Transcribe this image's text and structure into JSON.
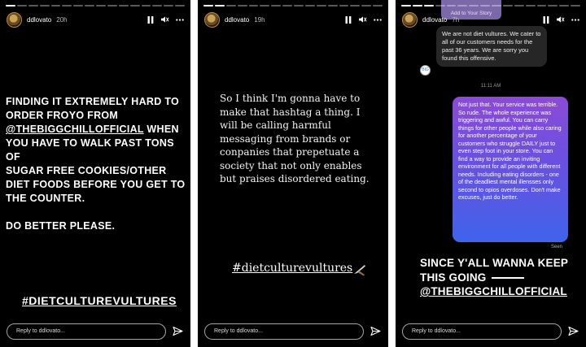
{
  "stories": [
    {
      "username": "ddlovato",
      "time": "20h",
      "progress": [
        1,
        0,
        0,
        0,
        0,
        0,
        0,
        0,
        0,
        0,
        0,
        0,
        0,
        0,
        0,
        0
      ],
      "text_lines": [
        "FINDING IT EXTREMELY HARD TO",
        "ORDER FROYO FROM",
        "@THEBIGGCHILLOFFICIAL",
        "WHEN",
        "YOU HAVE TO WALK PAST TONS OF",
        "SUGAR FREE COOKIES/OTHER",
        "DIET FOODS BEFORE YOU GET TO",
        "THE COUNTER.",
        "DO BETTER PLEASE."
      ],
      "hashtag": "#DIETCULTUREVULTURES",
      "reply_placeholder": "Reply to ddlovato..."
    },
    {
      "username": "ddlovato",
      "time": "19h",
      "progress": [
        1,
        1,
        0,
        0,
        0,
        0,
        0,
        0,
        0,
        0,
        0,
        0,
        0,
        0,
        0,
        0
      ],
      "text": "So I think I'm gonna have to make that hashtag a thing. I will be calling harmful messaging from brands or conpanies that prepetuate a society that not only enables but praises disordered eating.",
      "hashtag": "#dietculturevultures",
      "reply_placeholder": "Reply to ddlovato..."
    },
    {
      "username": "ddlovato",
      "time": "7h",
      "progress": [
        1,
        1,
        1,
        0,
        0,
        0,
        0,
        0,
        0,
        0,
        0,
        0,
        0,
        0,
        0,
        0
      ],
      "add_to_story": "Add to Your Story",
      "dm_received": "We are not diet vultures. We cater to all of our customers needs for the past 36 years. We are sorry you found this offensive.",
      "dm_avatar_text": "BIG",
      "dm_time": "11:11 AM",
      "dm_sent": "Not just that. Your service was terrible. So rude. The whole experience was triggering and awful. You can carry things for other people while also caring for another percentage of your customers who struggle DAILY just to even step foot in your store. You can find a way to provide an inviting environment for all people with different needs. Including eating disorders - one of the deadliest mental illensses only second to opios overdoses. Don't make excuses, just do better.",
      "seen": "Seen",
      "caption_line1": "SINCE Y'ALL WANNA KEEP",
      "caption_line2": "THIS GOING",
      "caption_line3": "@THEBIGGCHILLOFFICIAL",
      "reply_placeholder": "Reply to ddlovato..."
    }
  ],
  "icons": {
    "pause": "pause-icon",
    "mute": "speaker-icon",
    "more": "more-icon",
    "send": "send-icon"
  },
  "colors": {
    "background": "#000000",
    "dm_gradient_top": "#8b4bd6",
    "dm_gradient_bottom": "#3f63ea",
    "dm_received_bg": "#262626"
  }
}
